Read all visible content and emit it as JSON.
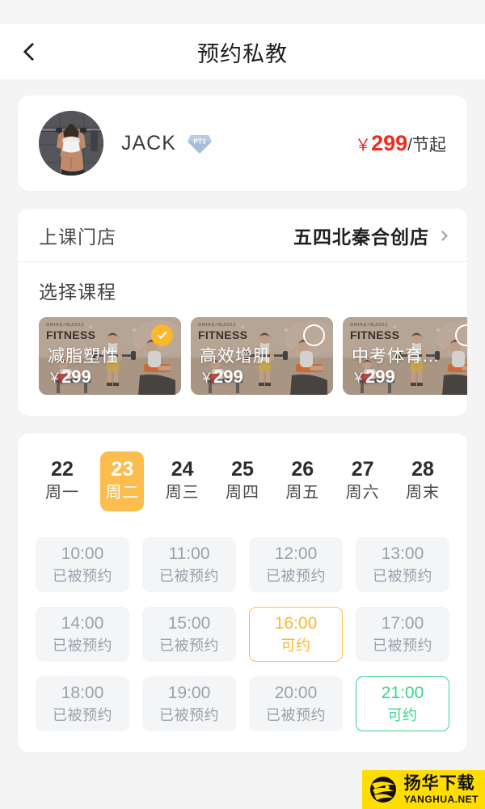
{
  "nav": {
    "back_icon": "chevron-left-icon",
    "title": "预约私教"
  },
  "coach": {
    "avatar_alt": "coach-avatar",
    "name": "JACK",
    "badge": "PT1",
    "price_currency": "￥",
    "price_amount": "299",
    "price_unit": "/节起"
  },
  "store": {
    "label": "上课门店",
    "value": "五四北秦合创店",
    "chevron_icon": "chevron-right-icon"
  },
  "courses": {
    "title": "选择课程",
    "items": [
      {
        "brand_small": "DNIKE+BJDSJ",
        "brand_big": "FITNESS",
        "name": "减脂塑性",
        "currency": "￥",
        "price": "299",
        "selected": true
      },
      {
        "brand_small": "DNIKE+BJDSJ",
        "brand_big": "FITNESS",
        "name": "高效增肌",
        "currency": "￥",
        "price": "299",
        "selected": false
      },
      {
        "brand_small": "DNIKE+BJDSJ",
        "brand_big": "FITNESS",
        "name": "中考体育...",
        "currency": "￥",
        "price": "299",
        "selected": false
      }
    ]
  },
  "schedule": {
    "dates": [
      {
        "day": "22",
        "weekday": "周一",
        "active": false
      },
      {
        "day": "23",
        "weekday": "周二",
        "active": true
      },
      {
        "day": "24",
        "weekday": "周三",
        "active": false
      },
      {
        "day": "25",
        "weekday": "周四",
        "active": false
      },
      {
        "day": "26",
        "weekday": "周五",
        "active": false
      },
      {
        "day": "27",
        "weekday": "周六",
        "active": false
      },
      {
        "day": "28",
        "weekday": "周末",
        "active": false
      }
    ],
    "slots": [
      {
        "time": "10:00",
        "status": "已被预约",
        "state": "booked"
      },
      {
        "time": "11:00",
        "status": "已被预约",
        "state": "booked"
      },
      {
        "time": "12:00",
        "status": "已被预约",
        "state": "booked"
      },
      {
        "time": "13:00",
        "status": "已被预约",
        "state": "booked"
      },
      {
        "time": "14:00",
        "status": "已被预约",
        "state": "booked"
      },
      {
        "time": "15:00",
        "status": "已被预约",
        "state": "booked"
      },
      {
        "time": "16:00",
        "status": "可约",
        "state": "available-amber"
      },
      {
        "time": "17:00",
        "status": "已被预约",
        "state": "booked"
      },
      {
        "time": "18:00",
        "status": "已被预约",
        "state": "booked"
      },
      {
        "time": "19:00",
        "status": "已被预约",
        "state": "booked"
      },
      {
        "time": "20:00",
        "status": "已被预约",
        "state": "booked"
      },
      {
        "time": "21:00",
        "status": "可约",
        "state": "available-green"
      }
    ]
  },
  "watermark": {
    "cn": "扬华下载",
    "en": "YANGHUA.NET"
  },
  "colors": {
    "page_bg": "#f4f4f4",
    "card_bg": "#ffffff",
    "accent_amber": "#fbbd4d",
    "accent_green": "#3fd18b",
    "price_red": "#f02c1d",
    "slot_bg": "#f4f5f7",
    "slot_text": "#9ba1ab",
    "watermark_bg": "#ffdd00"
  }
}
